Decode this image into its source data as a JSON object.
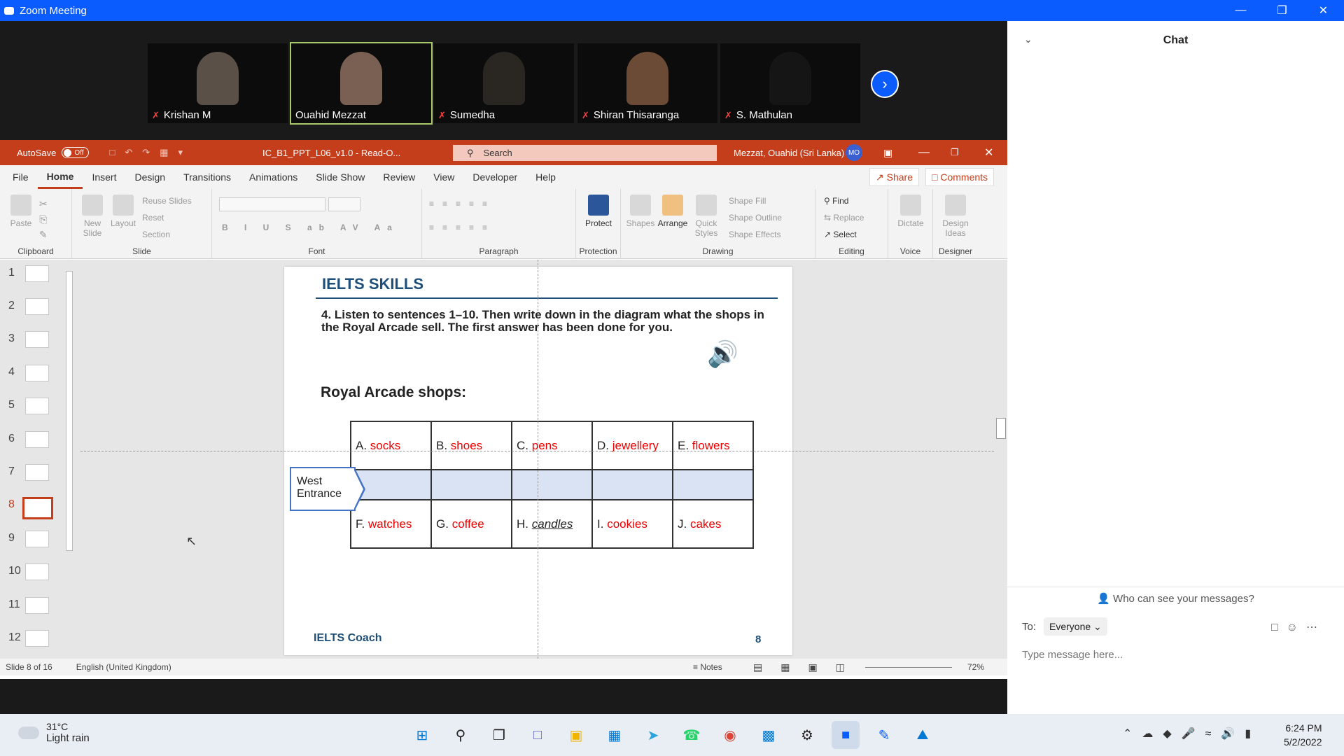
{
  "window": {
    "title": "Zoom Meeting"
  },
  "participants": [
    {
      "name": "Krishan M",
      "muted": true
    },
    {
      "name": "Ouahid Mezzat",
      "muted": false,
      "active": true
    },
    {
      "name": "Sumedha",
      "muted": true
    },
    {
      "name": "Shiran Thisaranga",
      "muted": true
    },
    {
      "name": "S. Mathulan",
      "muted": true
    }
  ],
  "powerpoint": {
    "autosave_label": "AutoSave",
    "autosave_state": "Off",
    "filename": "IC_B1_PPT_L06_v1.0  -  Read-O...",
    "search_placeholder": "Search",
    "user": "Mezzat, Ouahid (Sri Lanka)",
    "user_initials": "MO",
    "share_label": "Share",
    "comments_label": "Comments",
    "tabs": [
      "File",
      "Home",
      "Insert",
      "Design",
      "Transitions",
      "Animations",
      "Slide Show",
      "Review",
      "View",
      "Developer",
      "Help"
    ],
    "ribbon": {
      "clipboard": {
        "paste": "Paste",
        "group": "Clipboard"
      },
      "slide": {
        "new_slide": "New Slide",
        "layout": "Layout",
        "reuse": "Reuse Slides",
        "reset": "Reset",
        "section": "Section",
        "group": "Slide"
      },
      "font": {
        "group": "Font"
      },
      "paragraph": {
        "group": "Paragraph"
      },
      "protection": {
        "protect": "Protect",
        "group": "Protection"
      },
      "drawing": {
        "shapes": "Shapes",
        "arrange": "Arrange",
        "quick_styles": "Quick Styles",
        "fill": "Shape Fill",
        "outline": "Shape Outline",
        "effects": "Shape Effects",
        "group": "Drawing"
      },
      "editing": {
        "find": "Find",
        "replace": "Replace",
        "select": "Select",
        "group": "Editing"
      },
      "voice": {
        "dictate": "Dictate",
        "group": "Voice"
      },
      "designer": {
        "ideas": "Design Ideas",
        "group": "Designer"
      }
    },
    "thumbnails": [
      "1",
      "2",
      "3",
      "4",
      "5",
      "6",
      "7",
      "8",
      "9",
      "10",
      "11",
      "12"
    ],
    "selected_slide": 8,
    "status": {
      "slide": "Slide 8 of 16",
      "language": "English (United Kingdom)",
      "notes": "Notes",
      "zoom": "72%"
    }
  },
  "slide": {
    "header": "IELTS SKILLS",
    "question": "4. Listen to sentences 1–10. Then write down in the diagram what the shops in the Royal Arcade sell. The first answer has been done for you.",
    "subheading": "Royal Arcade shops:",
    "entrance": "West Entrance",
    "top_row": [
      {
        "letter": "A.",
        "item": "socks"
      },
      {
        "letter": "B.",
        "item": "shoes"
      },
      {
        "letter": "C.",
        "item": "pens"
      },
      {
        "letter": "D.",
        "item": "jewellery"
      },
      {
        "letter": "E.",
        "item": "flowers"
      }
    ],
    "bottom_row": [
      {
        "letter": "F.",
        "item": "watches"
      },
      {
        "letter": "G.",
        "item": "coffee"
      },
      {
        "letter": "H.",
        "item": "candles"
      },
      {
        "letter": "I.",
        "item": "cookies"
      },
      {
        "letter": "J.",
        "item": "cakes"
      }
    ],
    "footer": "IELTS Coach",
    "number": "8"
  },
  "chat": {
    "title": "Chat",
    "visibility": "Who can see your messages?",
    "to_label": "To:",
    "recipient": "Everyone",
    "placeholder": "Type message here..."
  },
  "taskbar": {
    "temperature": "31°C",
    "weather": "Light rain",
    "time": "6:24 PM",
    "date": "5/2/2022"
  },
  "colors": {
    "zoom_blue": "#0b5cff",
    "ppt_red": "#c43e1c",
    "answer_red": "#e00000",
    "slide_blue": "#1f4e79"
  }
}
